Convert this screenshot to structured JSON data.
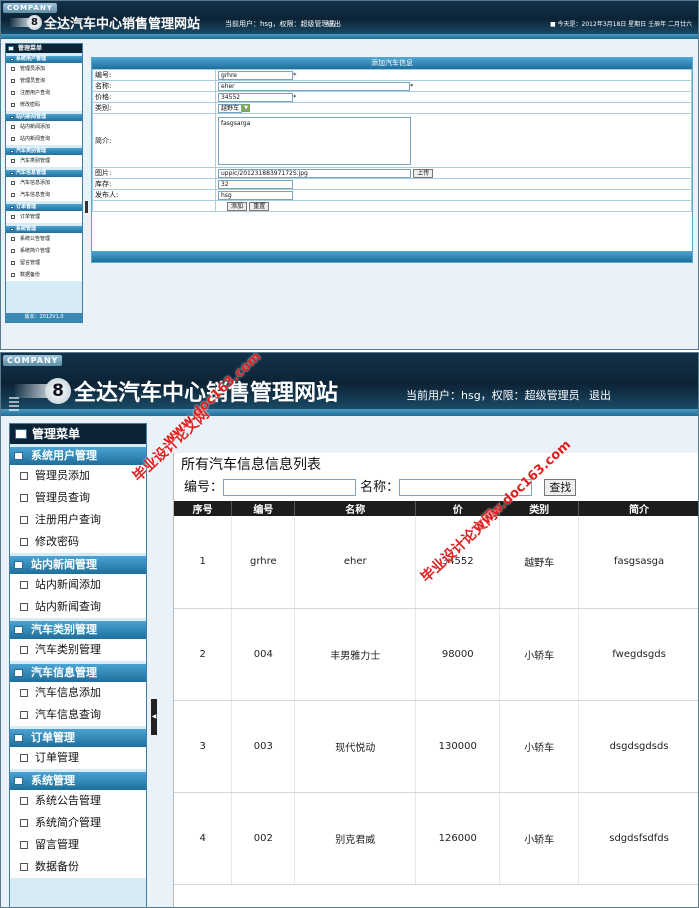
{
  "top": {
    "company_tag": "COMPANY",
    "badge": "8",
    "site_title": "全达汽车中心销售管理网站",
    "user_info": "当前用户：hsg，权限：超级管理员",
    "logout": "退出",
    "date_info": "今天是：2012年3月18日 星期日 壬辰年 二月廿六",
    "menu_title": "管理菜单",
    "groups": [
      {
        "title": "系统用户管理",
        "items": [
          "管理员添加",
          "管理员查询",
          "注册用户查询",
          "修改密码"
        ]
      },
      {
        "title": "站内新闻管理",
        "items": [
          "站内新闻添加",
          "站内新闻查询"
        ]
      },
      {
        "title": "汽车类别管理",
        "items": [
          "汽车类别管理"
        ]
      },
      {
        "title": "汽车信息管理",
        "items": [
          "汽车信息添加",
          "汽车信息查询"
        ]
      },
      {
        "title": "订单管理",
        "items": [
          "订单管理"
        ]
      },
      {
        "title": "系统管理",
        "items": [
          "系统公告管理",
          "系统简介管理",
          "留言管理",
          "数据备份"
        ]
      }
    ],
    "version": "版本：2012V1.0",
    "form": {
      "title": "添加汽车信息",
      "labels": {
        "code": "编号:",
        "name": "名称:",
        "price": "价格:",
        "category": "类别:",
        "intro": "简介:",
        "image": "图片:",
        "stock": "库存:",
        "publisher": "发布人:"
      },
      "values": {
        "code": "grhre",
        "name": "eher",
        "price": "34552",
        "category": "越野车",
        "intro": "fasgsarga",
        "image": "uppic/20123188397172S.jpg",
        "stock": "32",
        "publisher": "hsg"
      },
      "required_mark": "*",
      "upload_button": "上传",
      "add_button": "添加",
      "reset_button": "重置"
    }
  },
  "bottom": {
    "company_tag": "COMPANY",
    "badge": "8",
    "site_title": "全达汽车中心销售管理网站",
    "user_info": "当前用户：hsg，权限：超级管理员",
    "logout": "退出",
    "menu_title": "管理菜单",
    "groups": [
      {
        "title": "系统用户管理",
        "items": [
          "管理员添加",
          "管理员查询",
          "注册用户查询",
          "修改密码"
        ]
      },
      {
        "title": "站内新闻管理",
        "items": [
          "站内新闻添加",
          "站内新闻查询"
        ]
      },
      {
        "title": "汽车类别管理",
        "items": [
          "汽车类别管理"
        ]
      },
      {
        "title": "汽车信息管理",
        "items": [
          "汽车信息添加",
          "汽车信息查询"
        ]
      },
      {
        "title": "订单管理",
        "items": [
          "订单管理"
        ]
      },
      {
        "title": "系统管理",
        "items": [
          "系统公告管理",
          "系统简介管理",
          "留言管理",
          "数据备份"
        ]
      }
    ],
    "list": {
      "title": "所有汽车信息信息列表",
      "code_label": "编号：",
      "name_label": "名称：",
      "search_button": "查找",
      "columns": [
        "序号",
        "编号",
        "名称",
        "价",
        "类别",
        "简介"
      ],
      "rows": [
        [
          "1",
          "grhre",
          "eher",
          "34552",
          "越野车",
          "fasgsasga"
        ],
        [
          "2",
          "004",
          "丰男雅力士",
          "98000",
          "小轿车",
          "fwegdsgds"
        ],
        [
          "3",
          "003",
          "现代悦动",
          "130000",
          "小轿车",
          "dsgdsgdsds"
        ],
        [
          "4",
          "002",
          "别克君威",
          "126000",
          "小轿车",
          "sdgdsfsdfds"
        ]
      ]
    }
  },
  "watermarks": {
    "line1": "毕业设计论文网",
    "line2": "www.doc163.com"
  },
  "colors": {
    "header_dark": "#0c2335",
    "accent_blue": "#216d96",
    "menu_bg": "#d6ebf5",
    "watermark": "#e02020"
  }
}
